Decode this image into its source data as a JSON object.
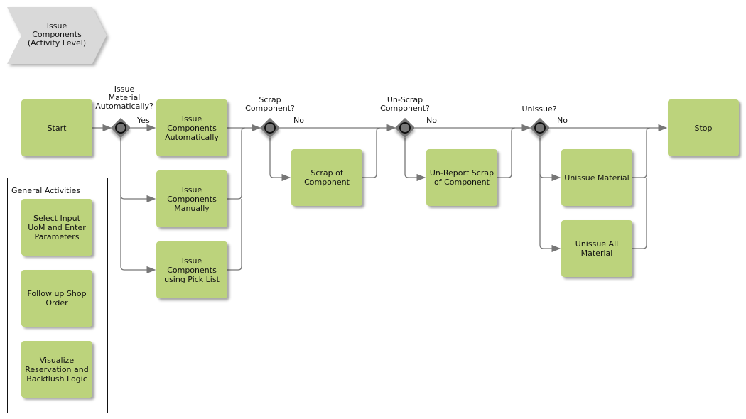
{
  "header": {
    "title": "Issue\nComponents\n(Activity Level)"
  },
  "activities": {
    "start": "Start",
    "issue_auto": "Issue\nComponents\nAutomatically",
    "issue_manual": "Issue\nComponents\nManually",
    "issue_picklist": "Issue\nComponents\nusing Pick List",
    "scrap": "Scrap of\nComponent",
    "unreport_scrap": "Un-Report Scrap\nof Component",
    "unissue_material": "Unissue Material",
    "unissue_all": "Unissue All\nMaterial",
    "stop": "Stop"
  },
  "gateways": {
    "issue_auto": "Issue\nMaterial\nAutomatically?",
    "scrap": "Scrap\nComponent?",
    "unscrap": "Un-Scrap\nComponent?",
    "unissue": "Unissue?"
  },
  "flow_labels": {
    "yes": "Yes",
    "no1": "No",
    "no2": "No",
    "no3": "No"
  },
  "general": {
    "title": "General Activities",
    "items": [
      "Select Input\nUoM and Enter\nParameters",
      "Follow up Shop\nOrder",
      "Visualize\nReservation and\nBackflush Logic"
    ]
  }
}
